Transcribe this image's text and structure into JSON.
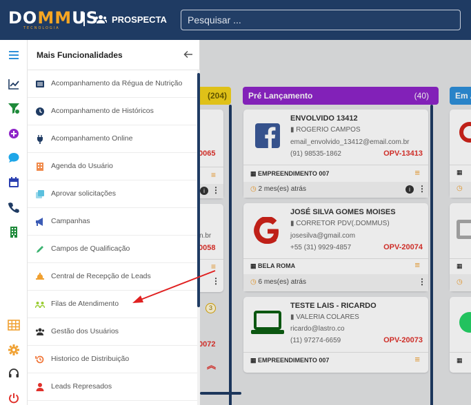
{
  "header": {
    "logo_main_left": "DO",
    "logo_main_mid": "MM",
    "logo_main_right": "US",
    "logo_sub": "TECNOLOGIA",
    "module_title": "PROSPECTA",
    "module_icon": "users-icon",
    "search_placeholder": "Pesquisar ..."
  },
  "rail": {
    "icons": [
      "menu-icon",
      "chart-line-icon",
      "filter-icon",
      "plus-circle-icon",
      "chat-icon",
      "calendar-icon",
      "phone-icon",
      "building-icon",
      "grid-icon",
      "gear-icon",
      "headset-icon",
      "power-icon"
    ]
  },
  "panel": {
    "title": "Mais Funcionalidades",
    "back_icon": "arrow-left-icon",
    "items": [
      {
        "label": "Acompanhamento da Régua de Nutrição",
        "icon": "list-icon",
        "color": "#1f3b63"
      },
      {
        "label": "Acompanhamento de Históricos",
        "icon": "clock-icon",
        "color": "#1f3b63"
      },
      {
        "label": "Acompanhamento Online",
        "icon": "plug-icon",
        "color": "#1f3b63"
      },
      {
        "label": "Agenda do Usuário",
        "icon": "calendar-grid-icon",
        "color": "#f08a4b"
      },
      {
        "label": "Aprovar solicitações",
        "icon": "copy-icon",
        "color": "#5bc0de"
      },
      {
        "label": "Campanhas",
        "icon": "megaphone-icon",
        "color": "#3b5bb5"
      },
      {
        "label": "Campos de Qualificação",
        "icon": "pencil-icon",
        "color": "#3cb371"
      },
      {
        "label": "Central de Recepção de Leads",
        "icon": "bell-icon",
        "color": "#f0a030"
      },
      {
        "label": "Filas de Atendimento",
        "icon": "queue-icon",
        "color": "#9acd32"
      },
      {
        "label": "Gestão dos Usuários",
        "icon": "users-icon",
        "color": "#333333"
      },
      {
        "label": "Historico de Distribuição",
        "icon": "history-icon",
        "color": "#f07030"
      },
      {
        "label": "Leads Represados",
        "icon": "user-icon",
        "color": "#e0312b"
      }
    ]
  },
  "board": {
    "col1_count": "(204)",
    "col2_title": "Pré Lançamento",
    "col2_count": "(40)",
    "col3_title": "Em A",
    "partial_left": {
      "opv1": "0065",
      "email_tail": "n.br",
      "opv2": "0058",
      "badge": "3",
      "opv3": "0072"
    },
    "cards": [
      {
        "name": "ENVOLVIDO 13412",
        "owner": "ROGERIO CAMPOS",
        "email": "email_envolvido_13412@email.com.br",
        "phone": "(91) 98535-1862",
        "opv": "OPV-13413",
        "empreendimento": "EMPREENDIMENTO 007",
        "time": "2 mes(es) atrás",
        "source_icon": "facebook-icon"
      },
      {
        "name": "JOSÉ SILVA GOMES MOISES",
        "owner": "CORRETOR PDV(.DOMMUS)",
        "email": "josesilva@gmail.com",
        "phone": "+55 (31) 9929-4857",
        "opv": "OPV-20074",
        "empreendimento": "BELA ROMA",
        "time": "6 mes(es) atrás",
        "source_icon": "google-icon"
      },
      {
        "name": "TESTE LAIS - RICARDO",
        "owner": "VALERIA COLARES",
        "email": "ricardo@lastro.co",
        "phone": "(11) 97274-6659",
        "opv": "OPV-20073",
        "empreendimento": "EMPREENDIMENTO 007",
        "time": "",
        "source_icon": "laptop-icon"
      }
    ]
  },
  "colors": {
    "header_bg": "#1f3b63",
    "accent_orange": "#f6a623",
    "col1_yellow": "#f2d21b",
    "col2_purple": "#8e24c8",
    "col3_blue": "#2d8fd9",
    "opv_red": "#e0312b",
    "annotation_arrow": "#e02020"
  }
}
